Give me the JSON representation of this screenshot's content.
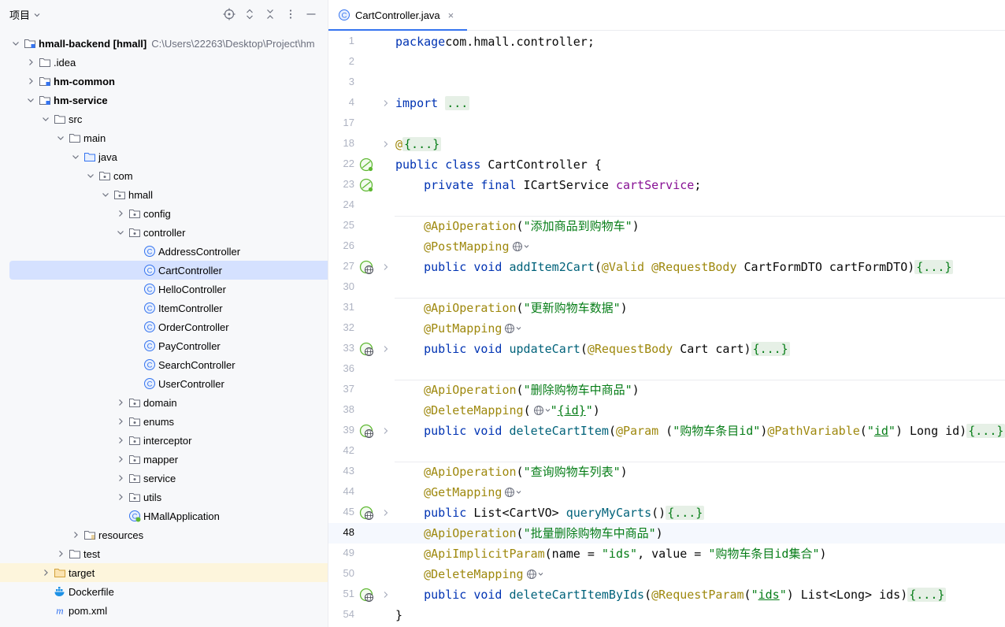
{
  "panel": {
    "title": "项目",
    "tree": [
      {
        "depth": 0,
        "label": "hmall-backend [hmall]",
        "path": "C:\\Users\\22263\\Desktop\\Project\\hm",
        "icon": "module-folder-icon",
        "chevron": "down",
        "bold": true
      },
      {
        "depth": 1,
        "label": ".idea",
        "icon": "folder-icon",
        "chevron": "right"
      },
      {
        "depth": 1,
        "label": "hm-common",
        "icon": "module-folder-icon",
        "chevron": "right",
        "bold": true
      },
      {
        "depth": 1,
        "label": "hm-service",
        "icon": "module-folder-icon",
        "chevron": "down",
        "bold": true
      },
      {
        "depth": 2,
        "label": "src",
        "icon": "folder-icon",
        "chevron": "down"
      },
      {
        "depth": 3,
        "label": "main",
        "icon": "folder-icon",
        "chevron": "down"
      },
      {
        "depth": 4,
        "label": "java",
        "icon": "source-folder-icon",
        "chevron": "down"
      },
      {
        "depth": 5,
        "label": "com",
        "icon": "package-icon",
        "chevron": "down"
      },
      {
        "depth": 6,
        "label": "hmall",
        "icon": "package-icon",
        "chevron": "down"
      },
      {
        "depth": 7,
        "label": "config",
        "icon": "package-icon",
        "chevron": "right"
      },
      {
        "depth": 7,
        "label": "controller",
        "icon": "package-icon",
        "chevron": "down"
      },
      {
        "depth": 8,
        "label": "AddressController",
        "icon": "class-icon",
        "chevron": "none"
      },
      {
        "depth": 8,
        "label": "CartController",
        "icon": "class-icon",
        "chevron": "none",
        "selected": true
      },
      {
        "depth": 8,
        "label": "HelloController",
        "icon": "class-icon",
        "chevron": "none"
      },
      {
        "depth": 8,
        "label": "ItemController",
        "icon": "class-icon",
        "chevron": "none"
      },
      {
        "depth": 8,
        "label": "OrderController",
        "icon": "class-icon",
        "chevron": "none"
      },
      {
        "depth": 8,
        "label": "PayController",
        "icon": "class-icon",
        "chevron": "none"
      },
      {
        "depth": 8,
        "label": "SearchController",
        "icon": "class-icon",
        "chevron": "none"
      },
      {
        "depth": 8,
        "label": "UserController",
        "icon": "class-icon",
        "chevron": "none"
      },
      {
        "depth": 7,
        "label": "domain",
        "icon": "package-icon",
        "chevron": "right"
      },
      {
        "depth": 7,
        "label": "enums",
        "icon": "package-icon",
        "chevron": "right"
      },
      {
        "depth": 7,
        "label": "interceptor",
        "icon": "package-icon",
        "chevron": "right"
      },
      {
        "depth": 7,
        "label": "mapper",
        "icon": "package-icon",
        "chevron": "right"
      },
      {
        "depth": 7,
        "label": "service",
        "icon": "package-icon",
        "chevron": "right"
      },
      {
        "depth": 7,
        "label": "utils",
        "icon": "package-icon",
        "chevron": "right"
      },
      {
        "depth": 7,
        "label": "HMallApplication",
        "icon": "spring-app-icon",
        "chevron": "none"
      },
      {
        "depth": 4,
        "label": "resources",
        "icon": "resources-folder-icon",
        "chevron": "right"
      },
      {
        "depth": 3,
        "label": "test",
        "icon": "folder-icon",
        "chevron": "right"
      },
      {
        "depth": 2,
        "label": "target",
        "icon": "excluded-folder-icon",
        "chevron": "right",
        "excluded": true
      },
      {
        "depth": 2,
        "label": "Dockerfile",
        "icon": "docker-icon",
        "chevron": "none"
      },
      {
        "depth": 2,
        "label": "pom.xml",
        "icon": "maven-icon",
        "chevron": "none"
      }
    ]
  },
  "editor": {
    "tab_label": "CartController.java",
    "tab_close": "×",
    "lines": [
      {
        "n": "1",
        "segs": [
          [
            "kw",
            "package"
          ],
          [
            "",
            "com.hmall.controller;"
          ]
        ]
      },
      {
        "n": "2",
        "segs": []
      },
      {
        "n": "3",
        "segs": []
      },
      {
        "n": "4",
        "fold": true,
        "segs": [
          [
            "kw",
            "import"
          ],
          [
            "",
            " "
          ],
          [
            "fo",
            "..."
          ]
        ]
      },
      {
        "n": "17",
        "segs": []
      },
      {
        "n": "18",
        "fold": true,
        "segs": [
          [
            "an",
            "@"
          ],
          [
            "fo",
            "{...}"
          ]
        ]
      },
      {
        "n": "22",
        "gutter": "bean",
        "segs": [
          [
            "kw",
            "public class"
          ],
          [
            "",
            " CartController {"
          ]
        ]
      },
      {
        "n": "23",
        "gutter": "bean",
        "segs": [
          [
            "",
            "    "
          ],
          [
            "kw",
            "private final"
          ],
          [
            "",
            " ICartService "
          ],
          [
            "fd",
            "cartService"
          ],
          [
            "",
            ";"
          ]
        ]
      },
      {
        "n": "24",
        "segs": []
      },
      {
        "n": "25",
        "sep": true,
        "segs": [
          [
            "",
            "    "
          ],
          [
            "an",
            "@ApiOperation"
          ],
          [
            "",
            "("
          ],
          [
            "st",
            "\"添加商品到购物车\""
          ],
          [
            "",
            ")"
          ]
        ]
      },
      {
        "n": "26",
        "segs": [
          [
            "",
            "    "
          ],
          [
            "an",
            "@PostMapping"
          ],
          [
            "globe",
            ""
          ]
        ]
      },
      {
        "n": "27",
        "gutter": "web",
        "fold": true,
        "segs": [
          [
            "",
            "    "
          ],
          [
            "kw",
            "public void"
          ],
          [
            "",
            " "
          ],
          [
            "mt",
            "addItem2Cart"
          ],
          [
            "",
            "("
          ],
          [
            "an",
            "@Valid"
          ],
          [
            "",
            " "
          ],
          [
            "an",
            "@RequestBody"
          ],
          [
            "",
            " CartFormDTO cartFormDTO)"
          ],
          [
            "fo",
            "{...}"
          ]
        ]
      },
      {
        "n": "30",
        "segs": []
      },
      {
        "n": "31",
        "sep": true,
        "segs": [
          [
            "",
            "    "
          ],
          [
            "an",
            "@ApiOperation"
          ],
          [
            "",
            "("
          ],
          [
            "st",
            "\"更新购物车数据\""
          ],
          [
            "",
            ")"
          ]
        ]
      },
      {
        "n": "32",
        "segs": [
          [
            "",
            "    "
          ],
          [
            "an",
            "@PutMapping"
          ],
          [
            "globe",
            ""
          ]
        ]
      },
      {
        "n": "33",
        "gutter": "web",
        "fold": true,
        "segs": [
          [
            "",
            "    "
          ],
          [
            "kw",
            "public void"
          ],
          [
            "",
            " "
          ],
          [
            "mt",
            "updateCart"
          ],
          [
            "",
            "("
          ],
          [
            "an",
            "@RequestBody"
          ],
          [
            "",
            " Cart cart)"
          ],
          [
            "fo",
            "{...}"
          ]
        ]
      },
      {
        "n": "36",
        "segs": []
      },
      {
        "n": "37",
        "sep": true,
        "segs": [
          [
            "",
            "    "
          ],
          [
            "an",
            "@ApiOperation"
          ],
          [
            "",
            "("
          ],
          [
            "st",
            "\"删除购物车中商品\""
          ],
          [
            "",
            ")"
          ]
        ]
      },
      {
        "n": "38",
        "segs": [
          [
            "",
            "    "
          ],
          [
            "an",
            "@DeleteMapping"
          ],
          [
            "",
            "("
          ],
          [
            "globe",
            ""
          ],
          [
            "st",
            "\""
          ],
          [
            "stul",
            "{id}"
          ],
          [
            "st",
            "\""
          ],
          [
            "",
            ")"
          ]
        ]
      },
      {
        "n": "39",
        "gutter": "web",
        "fold": true,
        "segs": [
          [
            "",
            "    "
          ],
          [
            "kw",
            "public void"
          ],
          [
            "",
            " "
          ],
          [
            "mt",
            "deleteCartItem"
          ],
          [
            "",
            "("
          ],
          [
            "an",
            "@Param"
          ],
          [
            "",
            " ("
          ],
          [
            "st",
            "\"购物车条目id\""
          ],
          [
            "",
            ")"
          ],
          [
            "an",
            "@PathVariable"
          ],
          [
            "",
            "("
          ],
          [
            "st",
            "\""
          ],
          [
            "stul",
            "id"
          ],
          [
            "st",
            "\""
          ],
          [
            "",
            ") Long id)"
          ],
          [
            "fo",
            "{...}"
          ]
        ]
      },
      {
        "n": "42",
        "segs": []
      },
      {
        "n": "43",
        "sep": true,
        "segs": [
          [
            "",
            "    "
          ],
          [
            "an",
            "@ApiOperation"
          ],
          [
            "",
            "("
          ],
          [
            "st",
            "\"查询购物车列表\""
          ],
          [
            "",
            ")"
          ]
        ]
      },
      {
        "n": "44",
        "segs": [
          [
            "",
            "    "
          ],
          [
            "an",
            "@GetMapping"
          ],
          [
            "globe",
            ""
          ]
        ]
      },
      {
        "n": "45",
        "gutter": "web",
        "fold": true,
        "segs": [
          [
            "",
            "    "
          ],
          [
            "kw",
            "public"
          ],
          [
            "",
            " List<CartVO> "
          ],
          [
            "mt",
            "queryMyCarts"
          ],
          [
            "",
            "()"
          ],
          [
            "fo",
            "{...}"
          ]
        ]
      },
      {
        "n": "48",
        "current": true,
        "segs": [
          [
            "",
            "    "
          ],
          [
            "an",
            "@ApiOperation"
          ],
          [
            "",
            "("
          ],
          [
            "st",
            "\"批量删除购物车中商品\""
          ],
          [
            "",
            ")"
          ]
        ]
      },
      {
        "n": "49",
        "segs": [
          [
            "",
            "    "
          ],
          [
            "an",
            "@ApiImplicitParam"
          ],
          [
            "",
            "(name = "
          ],
          [
            "st",
            "\"ids\""
          ],
          [
            "",
            ", value = "
          ],
          [
            "st",
            "\"购物车条目id集合\""
          ],
          [
            "",
            ")"
          ]
        ]
      },
      {
        "n": "50",
        "segs": [
          [
            "",
            "    "
          ],
          [
            "an",
            "@DeleteMapping"
          ],
          [
            "globe",
            ""
          ]
        ]
      },
      {
        "n": "51",
        "gutter": "web",
        "fold": true,
        "segs": [
          [
            "",
            "    "
          ],
          [
            "kw",
            "public void"
          ],
          [
            "",
            " "
          ],
          [
            "mt",
            "deleteCartItemByIds"
          ],
          [
            "",
            "("
          ],
          [
            "an",
            "@RequestParam"
          ],
          [
            "",
            "("
          ],
          [
            "st",
            "\""
          ],
          [
            "stul",
            "ids"
          ],
          [
            "st",
            "\""
          ],
          [
            "",
            ") List<Long> ids)"
          ],
          [
            "fo",
            "{...}"
          ]
        ]
      },
      {
        "n": "54",
        "segs": [
          [
            "",
            "}"
          ]
        ]
      }
    ]
  },
  "colors": {
    "keyword": "#0033b3",
    "annotation": "#9e880d",
    "string": "#067d17",
    "field": "#871094",
    "method": "#00627a",
    "selection": "#d5e1ff",
    "accent": "#3574f0"
  }
}
